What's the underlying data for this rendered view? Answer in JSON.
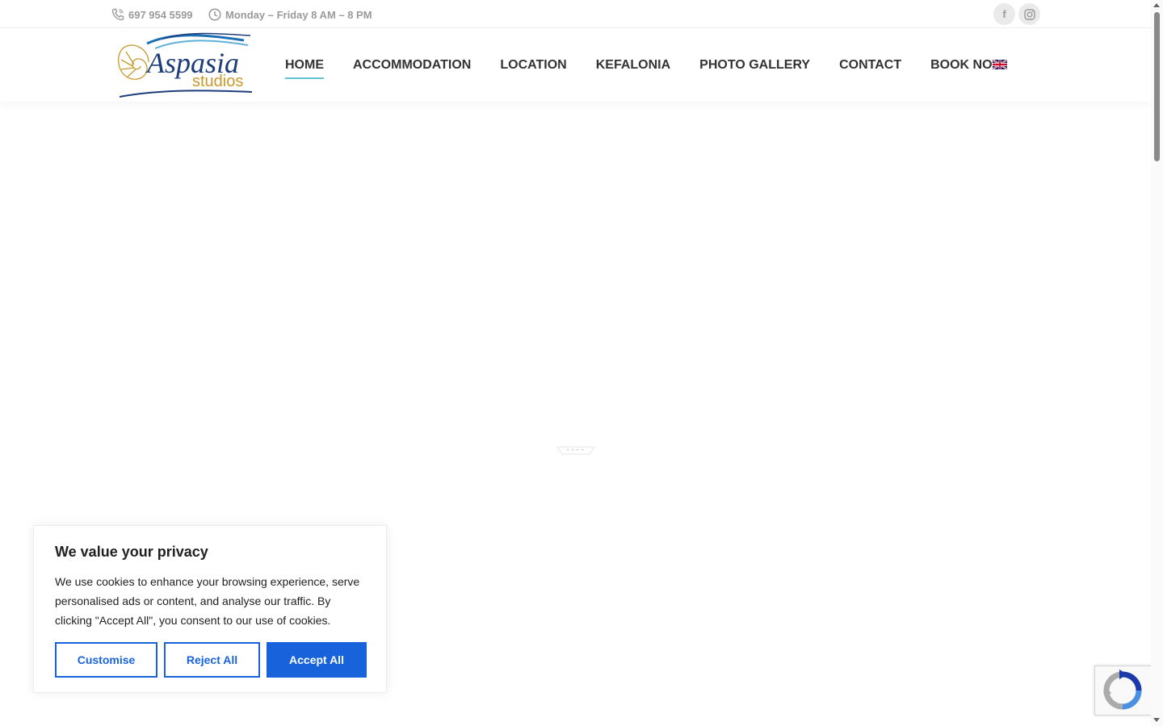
{
  "topbar": {
    "phone": "697 954 5599",
    "hours": "Monday – Friday 8 AM – 8 PM",
    "phone_icon": "phone-icon",
    "hours_icon": "clock-icon",
    "social": [
      {
        "name": "facebook-icon",
        "glyph": "f"
      },
      {
        "name": "instagram-icon",
        "glyph": "◎"
      }
    ]
  },
  "logo": {
    "line1": "Aspasia",
    "line2": "studios"
  },
  "nav": {
    "items": [
      {
        "label": "HOME",
        "active": true
      },
      {
        "label": "ACCOMMODATION",
        "active": false
      },
      {
        "label": "LOCATION",
        "active": false
      },
      {
        "label": "KEFALONIA",
        "active": false
      },
      {
        "label": "PHOTO GALLERY",
        "active": false
      },
      {
        "label": "CONTACT",
        "active": false
      },
      {
        "label": "BOOK NOW",
        "active": false
      }
    ],
    "language_icon": "uk-flag-icon"
  },
  "cookie": {
    "title": "We value your privacy",
    "text": "We use cookies to enhance your browsing experience, serve personalised ads or content, and analyse our traffic. By clicking \"Accept All\", you consent to our use of cookies.",
    "customise_label": "Customise",
    "reject_label": "Reject All",
    "accept_label": "Accept All"
  },
  "colors": {
    "accent": "#1863dc",
    "nav_underline": "#5fc3cf",
    "logo_blue": "#1d3d7a",
    "logo_gold": "#c89a2a"
  }
}
